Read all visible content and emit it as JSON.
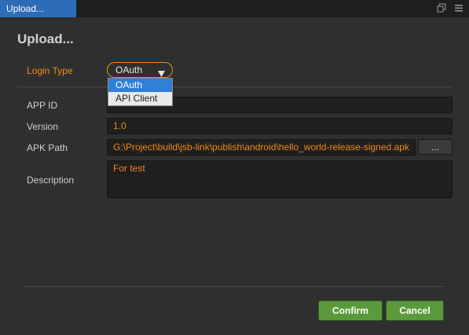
{
  "window": {
    "tab_title": "Upload..."
  },
  "dialog": {
    "title": "Upload..."
  },
  "form": {
    "login_type": {
      "label": "Login Type",
      "value": "OAuth",
      "options": [
        "OAuth",
        "API Client"
      ],
      "highlighted_option": "OAuth"
    },
    "app_id": {
      "label": "APP ID",
      "value": ""
    },
    "version": {
      "label": "Version",
      "value": "1.0"
    },
    "apk_path": {
      "label": "APK Path",
      "value": "G:\\Project\\build\\jsb-link\\publish\\android\\hello_world-release-signed.apk",
      "browse_label": "..."
    },
    "description": {
      "label": "Description",
      "value": "For test"
    }
  },
  "buttons": {
    "confirm": "Confirm",
    "cancel": "Cancel"
  },
  "colors": {
    "accent": "#f08a1a",
    "tab": "#2c6cb7",
    "confirm_button": "#5a9a3c",
    "selection": "#2e7fd8"
  },
  "icons": {
    "restore": "restore-window-icon",
    "menu": "hamburger-menu-icon",
    "caret": "caret-down-icon"
  }
}
